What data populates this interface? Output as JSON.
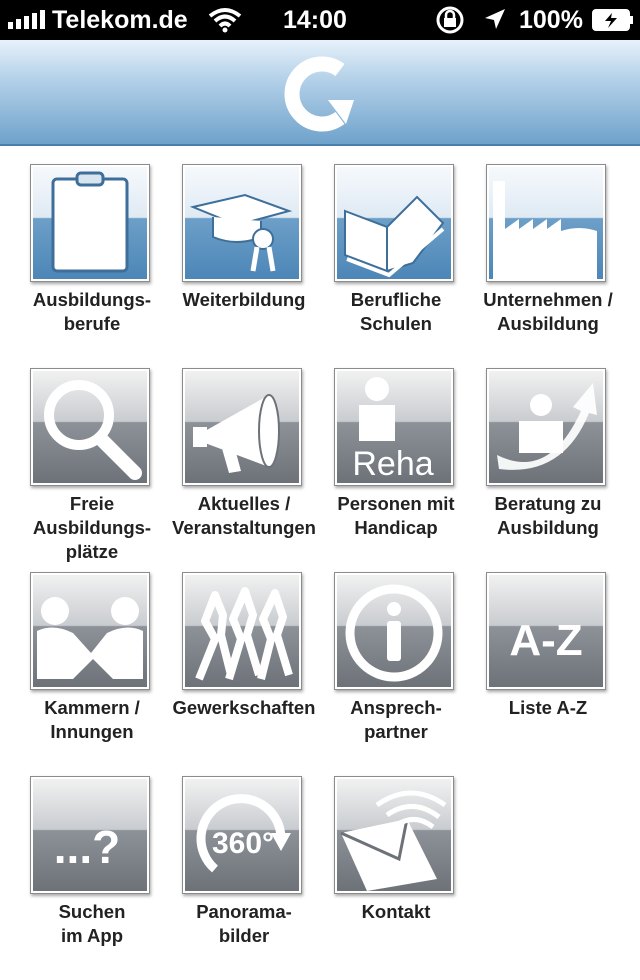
{
  "status_bar": {
    "carrier": "Telekom.de",
    "time": "14:00",
    "battery": "100%"
  },
  "header": {
    "logo_icon": "refresh-arrow-logo"
  },
  "tiles": [
    {
      "line1": "Ausbildungs-",
      "line2": "berufe",
      "line3": "",
      "icon": "clipboard-icon",
      "style": "blue"
    },
    {
      "line1": "Weiterbildung",
      "line2": "",
      "line3": "",
      "icon": "graduation-cap-icon",
      "style": "blue"
    },
    {
      "line1": "Berufliche",
      "line2": "Schulen",
      "line3": "",
      "icon": "open-book-icon",
      "style": "blue"
    },
    {
      "line1": "Unternehmen /",
      "line2": "Ausbildung",
      "line3": "",
      "icon": "factory-icon",
      "style": "blue"
    },
    {
      "line1": "Freie",
      "line2": "Ausbildungs-",
      "line3": "plätze",
      "icon": "magnifier-icon",
      "style": "gray"
    },
    {
      "line1": "Aktuelles /",
      "line2": "Veranstaltungen",
      "line3": "",
      "icon": "megaphone-icon",
      "style": "gray"
    },
    {
      "line1": "Personen mit",
      "line2": "Handicap",
      "line3": "",
      "icon": "reha-person-icon",
      "style": "gray",
      "icon_text": "Reha"
    },
    {
      "line1": "Beratung zu",
      "line2": "Ausbildung",
      "line3": "",
      "icon": "person-arrow-icon",
      "style": "gray"
    },
    {
      "line1": "Kammern /",
      "line2": "Innungen",
      "line3": "",
      "icon": "handshake-icon",
      "style": "gray"
    },
    {
      "line1": "Gewerkschaften",
      "line2": "",
      "line3": "",
      "icon": "group-people-icon",
      "style": "gray"
    },
    {
      "line1": "Ansprech-",
      "line2": "partner",
      "line3": "",
      "icon": "info-icon",
      "style": "gray"
    },
    {
      "line1": "Liste A-Z",
      "line2": "",
      "line3": "",
      "icon": "a-z-icon",
      "style": "gray",
      "icon_text": "A-Z"
    },
    {
      "line1": "Suchen",
      "line2": "im App",
      "line3": "",
      "icon": "search-question-icon",
      "style": "gray",
      "icon_text": "...?"
    },
    {
      "line1": "Panorama-",
      "line2": "bilder",
      "line3": "",
      "icon": "panorama-360-icon",
      "style": "gray",
      "icon_text": "360°"
    },
    {
      "line1": "Kontakt",
      "line2": "",
      "line3": "",
      "icon": "envelope-icon",
      "style": "gray"
    }
  ]
}
